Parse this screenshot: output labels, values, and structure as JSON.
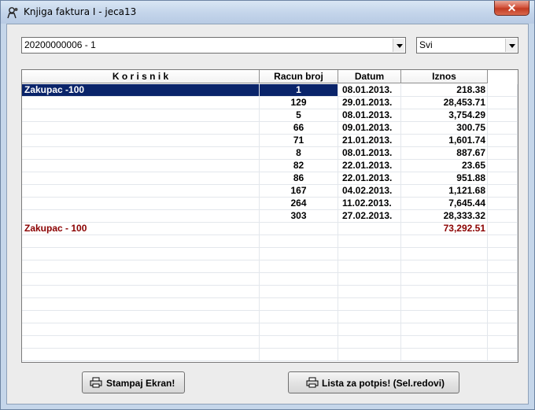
{
  "window": {
    "title": "Knjiga faktura I - jeca13",
    "close_glyph": "✕"
  },
  "filters": {
    "account": "20200000006 - 1",
    "scope": "Svi"
  },
  "table": {
    "columns": [
      "K o r i s n i k",
      "Racun broj",
      "Datum",
      "Iznos",
      ""
    ],
    "rows": [
      {
        "korisnik": "Zakupac -100",
        "racun": "1",
        "datum": "08.01.2013.",
        "iznos": "218.38",
        "selected": true
      },
      {
        "korisnik": "",
        "racun": "129",
        "datum": "29.01.2013.",
        "iznos": "28,453.71"
      },
      {
        "korisnik": "",
        "racun": "5",
        "datum": "08.01.2013.",
        "iznos": "3,754.29"
      },
      {
        "korisnik": "",
        "racun": "66",
        "datum": "09.01.2013.",
        "iznos": "300.75"
      },
      {
        "korisnik": "",
        "racun": "71",
        "datum": "21.01.2013.",
        "iznos": "1,601.74"
      },
      {
        "korisnik": "",
        "racun": "8",
        "datum": "08.01.2013.",
        "iznos": "887.67"
      },
      {
        "korisnik": "",
        "racun": "82",
        "datum": "22.01.2013.",
        "iznos": "23.65"
      },
      {
        "korisnik": "",
        "racun": "86",
        "datum": "22.01.2013.",
        "iznos": "951.88"
      },
      {
        "korisnik": "",
        "racun": "167",
        "datum": "04.02.2013.",
        "iznos": "1,121.68"
      },
      {
        "korisnik": "",
        "racun": "264",
        "datum": "11.02.2013.",
        "iznos": "7,645.44"
      },
      {
        "korisnik": "",
        "racun": "303",
        "datum": "27.02.2013.",
        "iznos": "28,333.32"
      },
      {
        "korisnik": "Zakupac - 100",
        "racun": "",
        "datum": "",
        "iznos": "73,292.51",
        "total": true
      }
    ]
  },
  "buttons": {
    "print_screen": "Stampaj Ekran!",
    "signature_list": "Lista za potpis! (Sel.redovi)"
  },
  "icons": {
    "app": "gear-person-icon",
    "print": "printer-icon"
  },
  "colors": {
    "selection": "#0a246a",
    "total_text": "#8b0000"
  }
}
